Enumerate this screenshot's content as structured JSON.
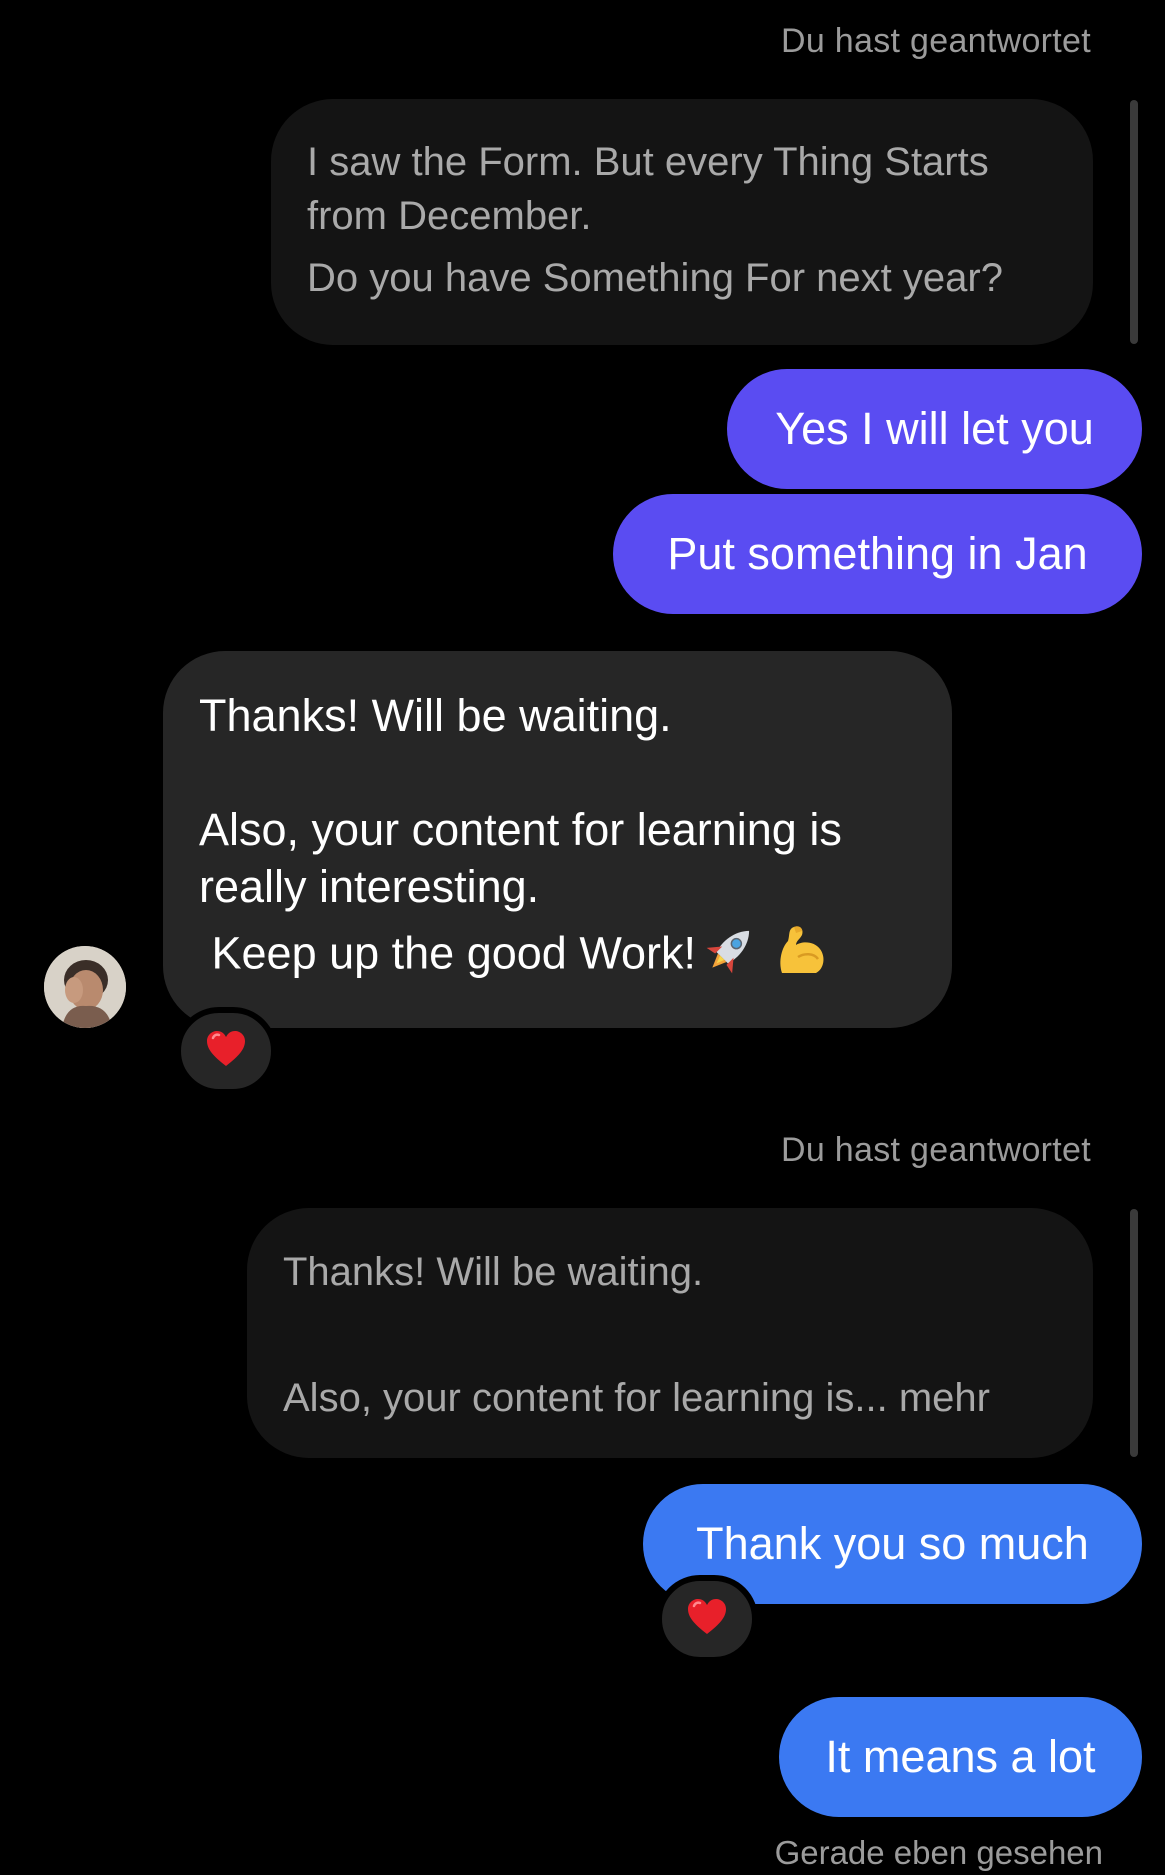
{
  "thread": {
    "reply_label_1": "Du hast geantwortet",
    "quote_1": {
      "lines": [
        "I saw the Form. But every Thing Starts",
        "from December.",
        "Do you have Something For next year?"
      ]
    },
    "sent_1": "Yes I will let you",
    "sent_2": "Put something in Jan",
    "received_1": {
      "lines": [
        "Thanks! Will be waiting.",
        "",
        "Also, your content for learning is",
        "really interesting.",
        " Keep up the good Work!"
      ],
      "reaction": "heart"
    },
    "reply_label_2": "Du hast geantwortet",
    "quote_2": {
      "lines": [
        "Thanks! Will be waiting.",
        "",
        "Also, your content for learning is... mehr"
      ]
    },
    "sent_3": "Thank you so much",
    "sent_3_reaction": "heart",
    "sent_4": "It means a lot",
    "seen_label": "Gerade eben gesehen"
  },
  "colors": {
    "background": "#000000",
    "sent_purple": "#5a4cf2",
    "sent_blue": "#3b79f2",
    "received_bubble": "#262626",
    "quote_bubble": "#141414",
    "muted_text": "#9b9b9b"
  },
  "icons": [
    "rocket-emoji",
    "flexed-biceps-emoji",
    "heart-icon",
    "avatar"
  ]
}
